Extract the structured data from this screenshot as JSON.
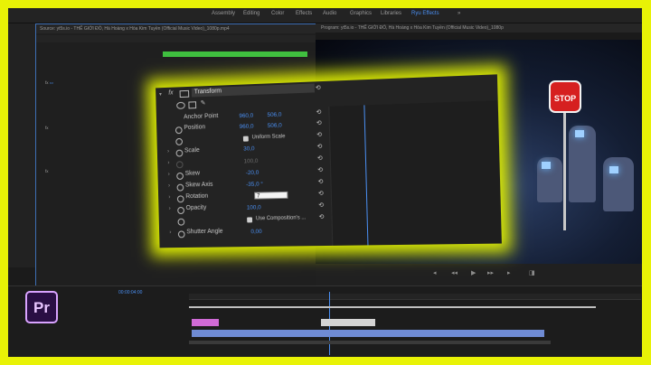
{
  "workspaces": [
    "Assembly",
    "Editing",
    "Color",
    "Effects",
    "Audio",
    "Graphics",
    "Libraries",
    "Ryu Effects"
  ],
  "active_workspace": "Ryu Effects",
  "source_tab": "Source: yt5s.io - THẾ GIỚI ĐỎ, Hà Hoàng x Hòa Kim Tuyền (Official Music Video)_1080p.mp4",
  "effect_controls_tab": "Effect Controls",
  "program_tab": "Program: yt5s.io - THẾ GIỚI ĐỎ, Hà Hoàng x Hòa Kim Tuyền (Official Music Video)_1080p",
  "overlay": {
    "fx": "fx",
    "section": "Transform",
    "anchor_point": {
      "label": "Anchor Point",
      "x": "960,0",
      "y": "506,0"
    },
    "position": {
      "label": "Position",
      "x": "960,0",
      "y": "506,0"
    },
    "uniform_scale": "Uniform Scale",
    "scale": {
      "label": "Scale",
      "value": "30,0"
    },
    "scale_width": "100,0",
    "skew": {
      "label": "Skew",
      "value": "-20,0"
    },
    "skew_axis": {
      "label": "Skew Axis",
      "value": "-35,0 °"
    },
    "rotation": {
      "label": "Rotation",
      "value": "7"
    },
    "opacity": {
      "label": "Opacity",
      "value": "100,0"
    },
    "use_comp": "Use Composition's ...",
    "shutter_angle": {
      "label": "Shutter Angle",
      "value": "0,00"
    }
  },
  "stop_sign": "STOP",
  "timeline": {
    "timecode": "00:00:04:00"
  },
  "premiere_logo": "Pr",
  "colors": {
    "accent": "#4a8ff2",
    "highlight": "#e8f206",
    "stop": "#d62020"
  }
}
